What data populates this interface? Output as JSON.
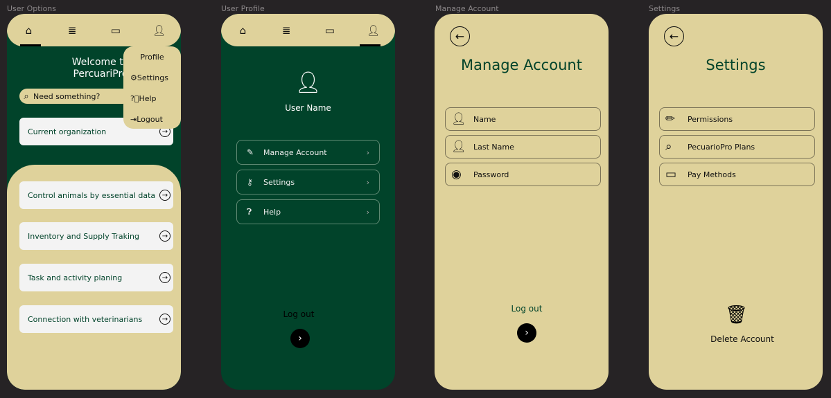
{
  "screens": {
    "user_options": {
      "label": "User Options",
      "welcome": "Welcome to PercuariPro",
      "search_placeholder": "Need something?",
      "current_org": "Current organization",
      "menu": [
        "Profile",
        "Settings",
        "Help",
        "Logout"
      ],
      "cards": [
        "Control animals by essential data",
        "Inventory and Supply Traking",
        "Task and activity planing",
        "Connection with veterinarians"
      ]
    },
    "user_profile": {
      "label": "User Profile",
      "user_name": "User Name",
      "items": [
        "Manage Account",
        "Settings",
        "Help"
      ],
      "logout": "Log out"
    },
    "manage_account": {
      "label": "Manage Account",
      "title": "Manage Account",
      "fields": [
        "Name",
        "Last Name",
        "Password"
      ],
      "logout": "Log out"
    },
    "settings": {
      "label": "Settings",
      "title": "Settings",
      "items": [
        "Permissions",
        "PecuarioPro Plans",
        "Pay Methods"
      ],
      "delete": "Delete Account"
    }
  },
  "colors": {
    "green": "#01432a",
    "tan": "#dfd29b",
    "bg": "#262325"
  }
}
